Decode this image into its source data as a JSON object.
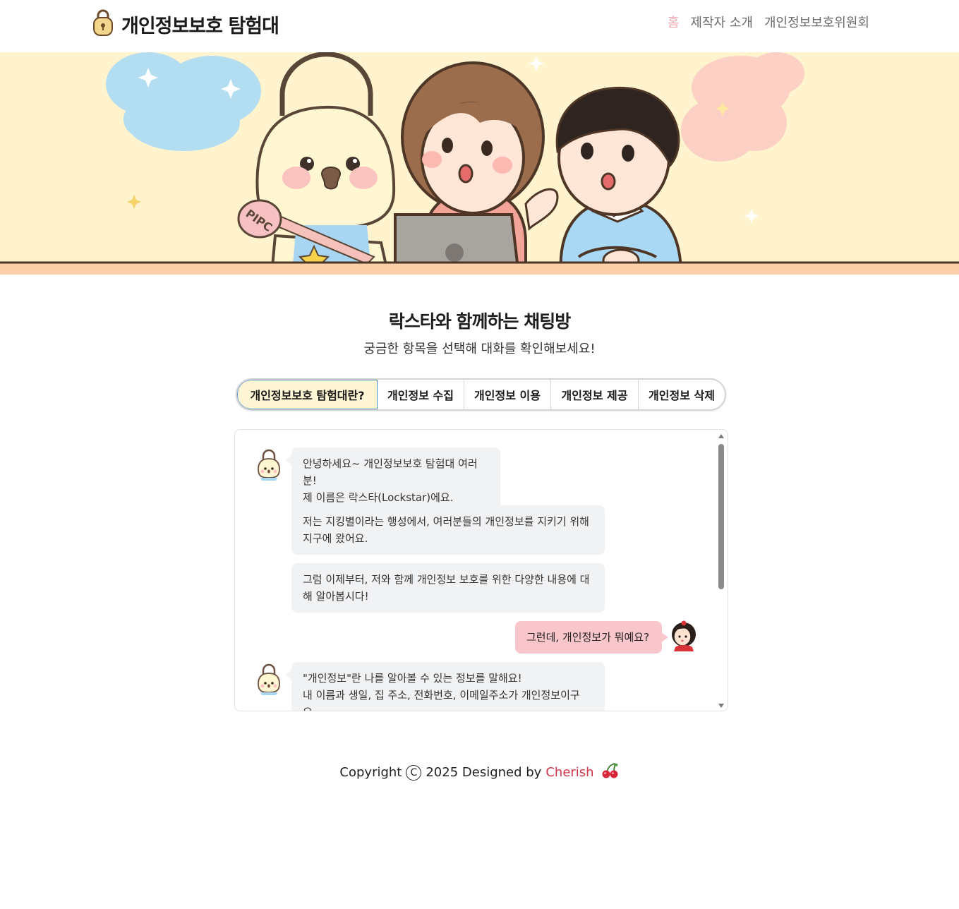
{
  "header": {
    "brand_title": "개인정보보호 탐험대",
    "nav": [
      {
        "label": "홈",
        "active": true
      },
      {
        "label": "제작자 소개",
        "active": false
      },
      {
        "label": "개인정보보호위원회",
        "active": false
      }
    ]
  },
  "hero": {
    "badge_text": "PIPC"
  },
  "section": {
    "title": "락스타와 함께하는 채팅방",
    "subtitle": "궁금한 항목을 선택해 대화를 확인해보세요!"
  },
  "tabs": [
    {
      "label": "개인정보보호 탐험대란?",
      "active": true
    },
    {
      "label": "개인정보 수집",
      "active": false
    },
    {
      "label": "개인정보 이용",
      "active": false
    },
    {
      "label": "개인정보 제공",
      "active": false
    },
    {
      "label": "개인정보 삭제",
      "active": false
    }
  ],
  "chat": {
    "messages": [
      {
        "sender": "lockstar",
        "lines": [
          "안녕하세요~ 개인정보보호 탐험대 여러분!",
          "제 이름은 락스타(Lockstar)에요."
        ]
      },
      {
        "sender": "lockstar",
        "lines": [
          "저는 지킹별이라는 행성에서, 여러분들의 개인정보를 지키기 위해",
          "지구에 왔어요."
        ]
      },
      {
        "sender": "lockstar",
        "lines": [
          "그럼 이제부터, 저와 함께 개인정보 보호를 위한 다양한 내용에 대",
          "해 알아봅시다!"
        ]
      },
      {
        "sender": "user",
        "lines": [
          "그런데, 개인정보가 뭐예요?"
        ]
      },
      {
        "sender": "lockstar",
        "lines": [
          "\"개인정보\"란 나를 알아볼 수 있는 정보를 말해요!",
          "내 이름과 생일, 집 주소, 전화번호, 이메일주소가 개인정보이구",
          "요."
        ]
      }
    ]
  },
  "footer": {
    "copyright_prefix": "Copyright",
    "copyright_symbol": "C",
    "year_text": "2025 Designed by",
    "author": "Cherish",
    "author_color": "#d0364a"
  },
  "colors": {
    "accent_pink": "#f3a5ae",
    "user_bubble": "#f9c6cc",
    "bot_bubble": "#f1f2f4",
    "hero_bg": "#fff4cd",
    "tab_active_bg": "#fff6d5",
    "tab_active_border": "#4a8fd4"
  }
}
